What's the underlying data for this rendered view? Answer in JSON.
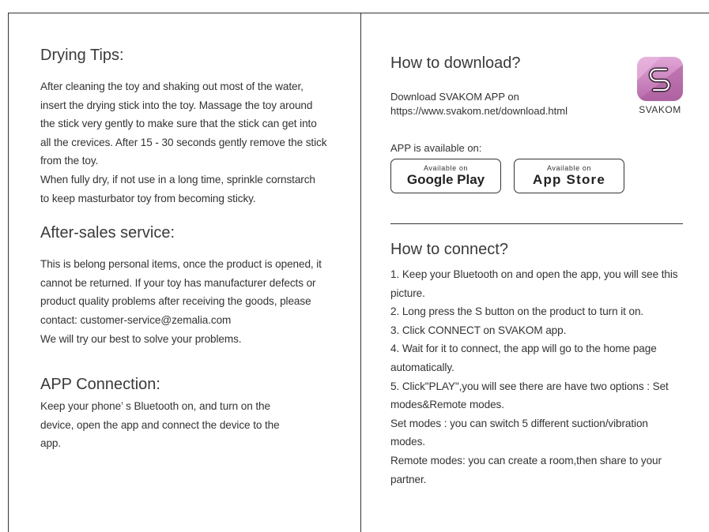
{
  "left": {
    "drying": {
      "title": "Drying Tips:",
      "lines": [
        "After cleaning the toy and shaking out most of the water,",
        "insert the drying stick into the toy. Massage the toy around",
        "the stick very gently to make sure that the stick can get into",
        "all the crevices. After 15 - 30 seconds gently remove the stick",
        "from the toy.",
        "When fully dry, if not use in a long time, sprinkle cornstarch",
        "to keep masturbator toy from becoming sticky."
      ]
    },
    "after_sales": {
      "title": "After-sales service:",
      "lines": [
        "This is belong personal items, once the product is opened, it",
        "cannot be returned. If your toy has manufacturer defects or",
        "product quality problems after receiving the goods, please",
        "contact: customer-service@zemalia.com",
        "We will try our best to solve your problems."
      ]
    },
    "app_connection": {
      "title": "APP Connection:",
      "lines": [
        "Keep your phone’ s Bluetooth on, and turn on the",
        "device, open the app and connect the device to the",
        "app."
      ]
    }
  },
  "right": {
    "download": {
      "title": "How to download?",
      "line1": "Download SVAKOM APP on",
      "line2": "https://www.svakom.net/download.html",
      "logo_text": "SVAKOM",
      "logo_icon": "svakom-s-logo-icon",
      "logo_colors": [
        "#e1a5d6",
        "#b96aab"
      ]
    },
    "stores": {
      "label": "APP is available on:",
      "google_small": "Available on",
      "google_big": "Google Play",
      "apple_small": "Available on",
      "apple_big": "App Store"
    },
    "connect": {
      "title": "How to connect?",
      "lines": [
        "1. Keep your Bluetooth on and open the app, you will see this",
        "picture.",
        "2. Long press the S button on the product to turn it on.",
        "3. Click CONNECT on SVAKOM app.",
        "4. Wait for it to connect, the app will go to the home page",
        "automatically.",
        "5. Click\"PLAY\",you will see there are have two options : Set",
        "modes&Remote modes.",
        "Set modes : you can switch 5 different suction/vibration",
        "modes.",
        "Remote modes: you can create a room,then share to your",
        "partner."
      ]
    }
  }
}
